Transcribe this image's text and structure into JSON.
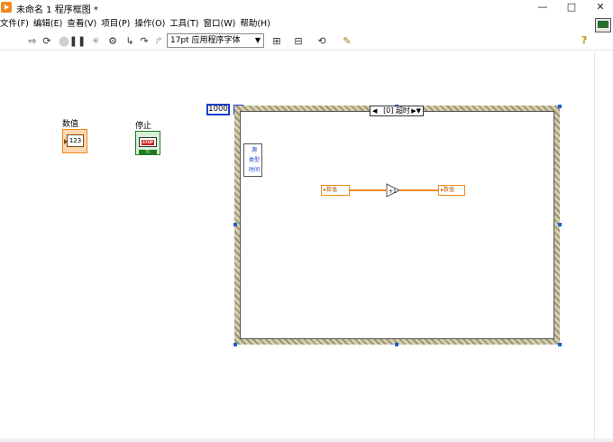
{
  "window": {
    "title": "未命名 1 程序框图 *",
    "controls": {
      "minimize": "—",
      "maximize": "□",
      "close": "✕"
    }
  },
  "menu": [
    "文件(F)",
    "编辑(E)",
    "查看(V)",
    "项目(P)",
    "操作(O)",
    "工具(T)",
    "窗口(W)",
    "帮助(H)"
  ],
  "toolbar": {
    "font": "17pt 应用程序字体",
    "font_arrow": "▼",
    "help": "?"
  },
  "diagram": {
    "numeric_label": "数值",
    "numeric_display": "123",
    "stop_label": "停止",
    "stop_text": "STOP",
    "stop_tf": "TF",
    "timeout_value": "1000",
    "case_selector": "[0] 超时",
    "event_data": [
      "源",
      "类型",
      "时间"
    ],
    "local_var_read": "数值",
    "local_var_write": "数值",
    "increment_symbol": "+1"
  }
}
